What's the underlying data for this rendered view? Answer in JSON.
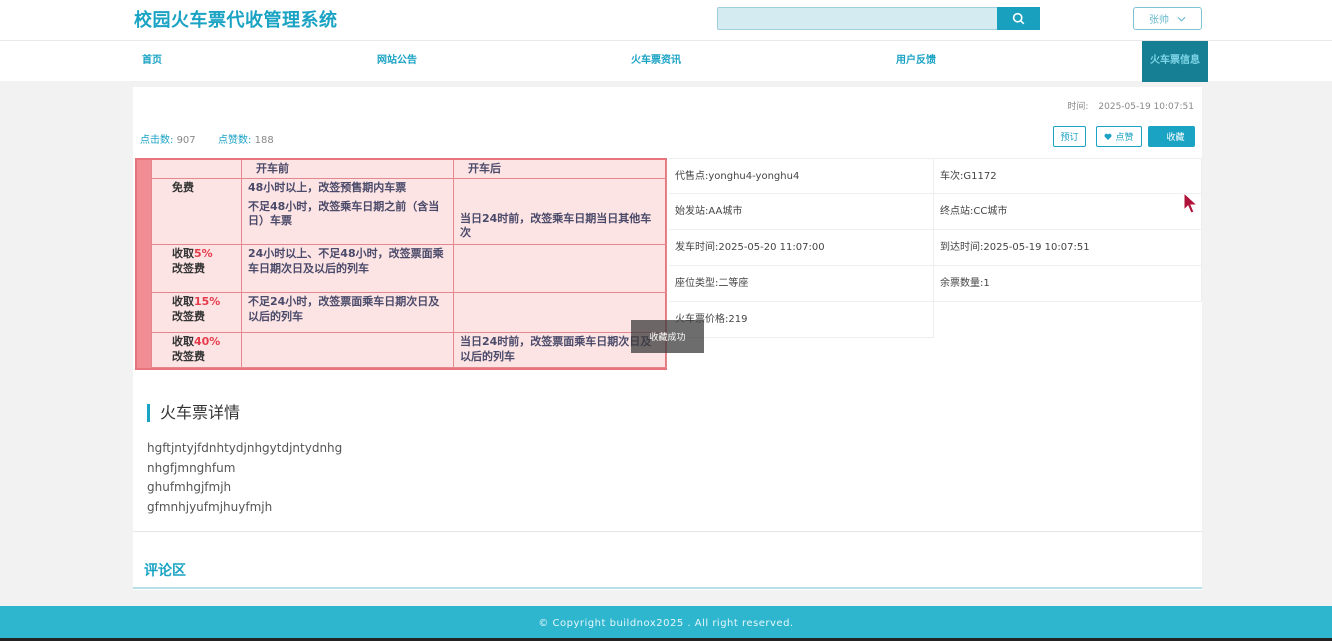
{
  "header": {
    "site_title": "校园火车票代收管理系统",
    "search_placeholder": "",
    "user_name": "张帅"
  },
  "nav": {
    "items": [
      "首页",
      "网站公告",
      "火车票资讯",
      "用户反馈",
      "火车票信息"
    ],
    "active_index": 4
  },
  "detail": {
    "time_label": "时间:",
    "time_value": "2025-05-19 10:07:51",
    "clicks_label": "点击数:",
    "clicks_value": "907",
    "likes_label": "点赞数:",
    "likes_value": "188",
    "btn_book": "预订",
    "btn_like": "点赞",
    "btn_fav": "收藏"
  },
  "ticket_image": {
    "col_before": "开车前",
    "col_after": "开车后",
    "rows": [
      {
        "label": "免费",
        "before1": "48小时以上，改签预售期内车票",
        "before2": "不足48小时，改签乘车日期之前（含当日）车票",
        "after": "当日24时前，改签乘车日期当日其他车次"
      },
      {
        "label_a": "收取",
        "label_pct": "5%",
        "label_b": "改签费",
        "before": "24小时以上、不足48小时，改签票面乘车日期次日及以后的列车",
        "after": ""
      },
      {
        "label_a": "收取",
        "label_pct": "15%",
        "label_b": "改签费",
        "before": "不足24小时，改签票面乘车日期次日及以后的列车",
        "after": ""
      },
      {
        "label_a": "收取",
        "label_pct": "40%",
        "label_b": "改签费",
        "before": "",
        "after": "当日24时前，改签票面乘车日期次日及以后的列车"
      }
    ]
  },
  "info": {
    "agent": "代售点:yonghu4-yonghu4",
    "train_no": "车次:G1172",
    "from": "始发站:AA城市",
    "to": "终点站:CC城市",
    "depart": "发车时间:2025-05-20 11:07:00",
    "arrive": "到达时间:2025-05-19 10:07:51",
    "seat": "座位类型:二等座",
    "remaining": "余票数量:1",
    "price": "火车票价格:219"
  },
  "toast": "收藏成功",
  "section_title": "火车票详情",
  "detail_lines": [
    "hgftjntyjfdnhtydjnhgytdjntydnhg",
    "nhgfjmnghfum",
    "ghufmhgjfmjh",
    "gfmnhjyufmjhuyfmjh"
  ],
  "comment_title": "评论区",
  "footer": "© Copyright buildnox2025 . All right reserved.",
  "colors": {
    "accent": "#1ba3c4",
    "nav_active_bg": "#177f93",
    "footer_bg": "#2fb6cf"
  }
}
